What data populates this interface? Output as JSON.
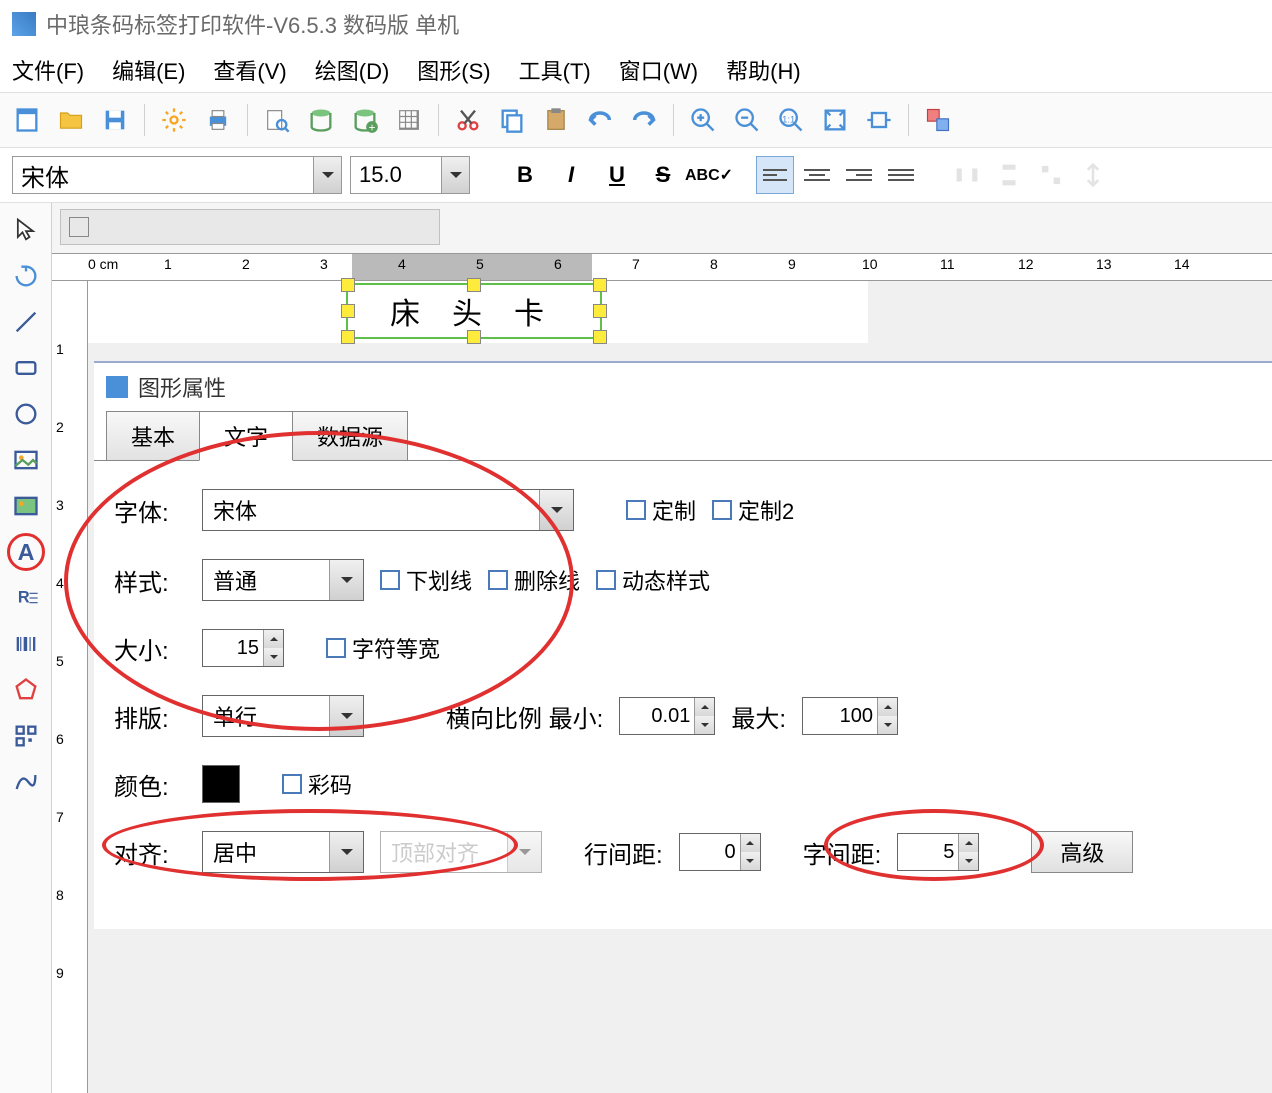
{
  "title": "中琅条码标签打印软件-V6.5.3 数码版 单机",
  "menu": {
    "file": "文件(F)",
    "edit": "编辑(E)",
    "view": "查看(V)",
    "draw": "绘图(D)",
    "graphic": "图形(S)",
    "tool": "工具(T)",
    "window": "窗口(W)",
    "help": "帮助(H)"
  },
  "font_toolbar": {
    "font_name": "宋体",
    "font_size": "15.0"
  },
  "ruler": {
    "unit": "0 cm",
    "marks_h": [
      "1",
      "2",
      "3",
      "4",
      "5",
      "6",
      "7",
      "8",
      "9",
      "10",
      "11",
      "12",
      "13",
      "14"
    ],
    "marks_v": [
      "1",
      "2",
      "3",
      "4",
      "5",
      "6",
      "7",
      "8",
      "9"
    ]
  },
  "canvas": {
    "text_content": "床头卡"
  },
  "dialog": {
    "title": "图形属性",
    "tabs": {
      "basic": "基本",
      "text": "文字",
      "datasource": "数据源"
    },
    "font_label": "字体:",
    "font_value": "宋体",
    "custom1": "定制",
    "custom2": "定制2",
    "style_label": "样式:",
    "style_value": "普通",
    "underline": "下划线",
    "strike": "删除线",
    "dynamic_style": "动态样式",
    "size_label": "大小:",
    "size_value": "15",
    "monospace": "字符等宽",
    "layout_label": "排版:",
    "layout_value": "单行",
    "hratio_label": "横向比例 最小:",
    "hratio_min": "0.01",
    "hratio_max_label": "最大:",
    "hratio_max": "100",
    "color_label": "颜色:",
    "color_code": "彩码",
    "align_label": "对齐:",
    "align_value": "居中",
    "valign_value": "顶部对齐",
    "line_spacing_label": "行间距:",
    "line_spacing": "0",
    "char_spacing_label": "字间距:",
    "char_spacing": "5",
    "advanced": "高级"
  }
}
